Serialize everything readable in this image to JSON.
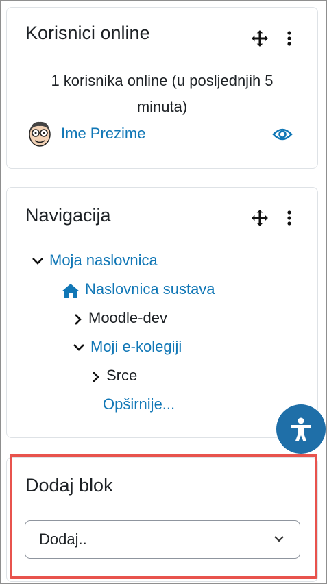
{
  "online_block": {
    "title": "Korisnici online",
    "summary_line1": "1 korisnika online (u posljednjih 5",
    "summary_line2": "minuta)",
    "users": [
      {
        "name": "Ime Prezime"
      }
    ]
  },
  "navigation_block": {
    "title": "Navigacija",
    "items": [
      {
        "label": "Moja naslovnica",
        "icon": "chevron-down-icon"
      },
      {
        "label": "Naslovnica sustava",
        "icon": "home-icon"
      },
      {
        "label": "Moodle-dev",
        "icon": "chevron-right-icon"
      },
      {
        "label": "Moji e-kolegiji",
        "icon": "chevron-down-icon"
      },
      {
        "label": "Srce",
        "icon": "chevron-right-icon"
      },
      {
        "label": "Opširnije..."
      }
    ]
  },
  "add_block": {
    "title": "Dodaj blok",
    "select_value": "Dodaj..",
    "highlight_color": "#e8534d"
  },
  "colors": {
    "link": "#1177b6",
    "accessibility_button": "#1f6fa8"
  }
}
